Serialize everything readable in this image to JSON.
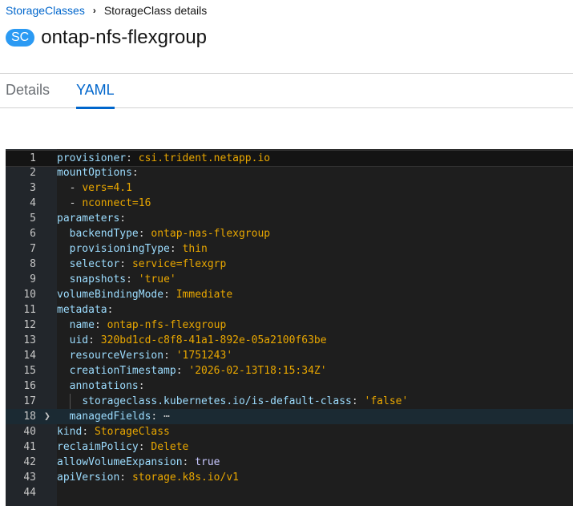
{
  "breadcrumb": {
    "parent": "StorageClasses",
    "current": "StorageClass details"
  },
  "header": {
    "badge": "SC",
    "title": "ontap-nfs-flexgroup"
  },
  "tabs": [
    {
      "label": "Details"
    },
    {
      "label": "YAML"
    }
  ],
  "editor": {
    "lines": [
      {
        "n": "1",
        "indent": 0,
        "dash": "",
        "key": "provisioner",
        "value": "csi.trident.netapp.io"
      },
      {
        "n": "2",
        "indent": 0,
        "dash": "",
        "key": "mountOptions",
        "value": ""
      },
      {
        "n": "3",
        "indent": 1,
        "dash": "- ",
        "key": "",
        "value": "vers=4.1"
      },
      {
        "n": "4",
        "indent": 1,
        "dash": "- ",
        "key": "",
        "value": "nconnect=16"
      },
      {
        "n": "5",
        "indent": 0,
        "dash": "",
        "key": "parameters",
        "value": ""
      },
      {
        "n": "6",
        "indent": 1,
        "dash": "",
        "key": "backendType",
        "value": "ontap-nas-flexgroup"
      },
      {
        "n": "7",
        "indent": 1,
        "dash": "",
        "key": "provisioningType",
        "value": "thin"
      },
      {
        "n": "8",
        "indent": 1,
        "dash": "",
        "key": "selector",
        "value": "service=flexgrp"
      },
      {
        "n": "9",
        "indent": 1,
        "dash": "",
        "key": "snapshots",
        "value": "'true'"
      },
      {
        "n": "10",
        "indent": 0,
        "dash": "",
        "key": "volumeBindingMode",
        "value": "Immediate"
      },
      {
        "n": "11",
        "indent": 0,
        "dash": "",
        "key": "metadata",
        "value": ""
      },
      {
        "n": "12",
        "indent": 1,
        "dash": "",
        "key": "name",
        "value": "ontap-nfs-flexgroup"
      },
      {
        "n": "13",
        "indent": 1,
        "dash": "",
        "key": "uid",
        "value": "320bd1cd-c8f8-41a1-892e-05a2100f63be"
      },
      {
        "n": "14",
        "indent": 1,
        "dash": "",
        "key": "resourceVersion",
        "value": "'1751243'"
      },
      {
        "n": "15",
        "indent": 1,
        "dash": "",
        "key": "creationTimestamp",
        "value": "'2026-02-13T18:15:34Z'"
      },
      {
        "n": "16",
        "indent": 1,
        "dash": "",
        "key": "annotations",
        "value": ""
      },
      {
        "n": "17",
        "indent": 2,
        "dash": "",
        "key": "storageclass.kubernetes.io/is-default-class",
        "value": "'false'"
      },
      {
        "n": "18",
        "indent": 1,
        "dash": "",
        "key": "managedFields",
        "value": "⋯",
        "folded": true
      },
      {
        "n": "40",
        "indent": 0,
        "dash": "",
        "key": "kind",
        "value": "StorageClass"
      },
      {
        "n": "41",
        "indent": 0,
        "dash": "",
        "key": "reclaimPolicy",
        "value": "Delete"
      },
      {
        "n": "42",
        "indent": 0,
        "dash": "",
        "key": "allowVolumeExpansion",
        "value": "true",
        "bool": true
      },
      {
        "n": "43",
        "indent": 0,
        "dash": "",
        "key": "apiVersion",
        "value": "storage.k8s.io/v1"
      },
      {
        "n": "44",
        "indent": 0,
        "dash": "",
        "key": "",
        "value": ""
      }
    ]
  }
}
